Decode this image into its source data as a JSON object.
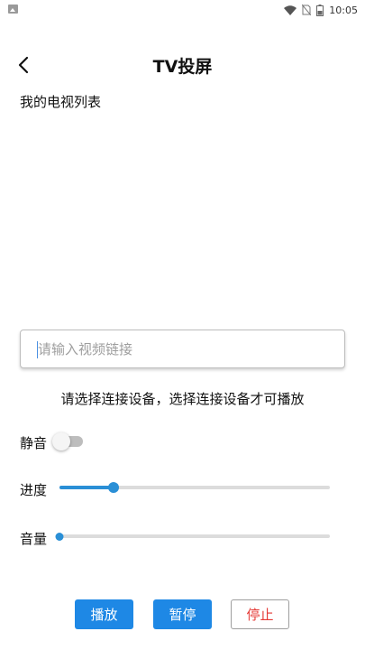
{
  "status_bar": {
    "time": "10:05",
    "icons": [
      "image-notification-icon",
      "wifi-icon",
      "no-sim-icon",
      "battery-icon"
    ]
  },
  "header": {
    "title": "TV投屏",
    "back_icon": "chevron-left-icon"
  },
  "device_section": {
    "label": "我的电视列表",
    "devices": []
  },
  "url_input": {
    "value": "",
    "placeholder": "请输入视频链接"
  },
  "hint": "请选择连接设备，选择连接设备才可播放",
  "controls": {
    "mute": {
      "label": "静音",
      "checked": false
    },
    "progress": {
      "label": "进度",
      "value_percent": 20
    },
    "volume": {
      "label": "音量",
      "value_percent": 0
    }
  },
  "buttons": {
    "play_label": "播放",
    "pause_label": "暂停",
    "stop_label": "停止"
  },
  "colors": {
    "accent": "#1e88e5",
    "stop_text": "#e53935",
    "slider_track": "#dcdcdc"
  }
}
